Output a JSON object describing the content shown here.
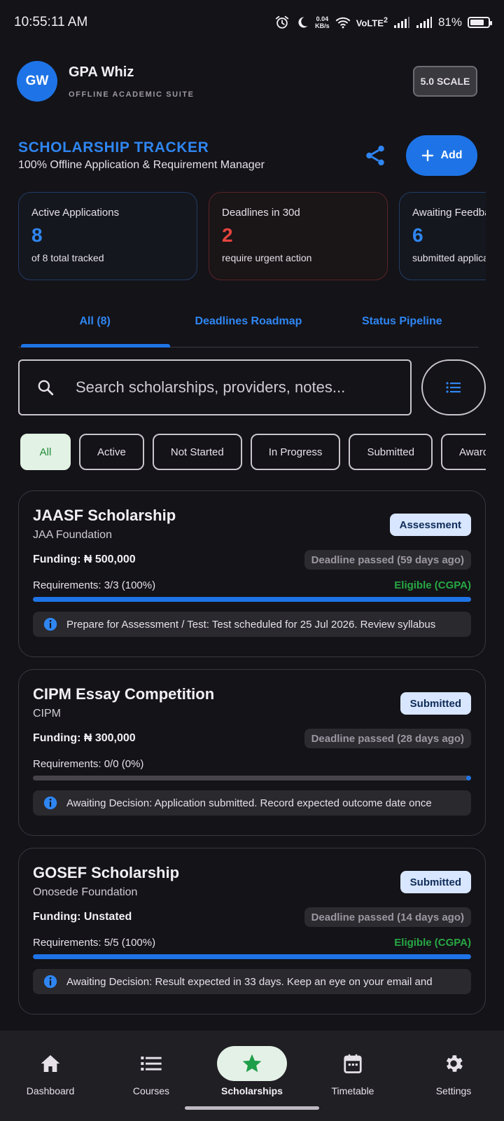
{
  "status_bar": {
    "time": "10:55:11 AM",
    "net_speed_value": "0.04",
    "net_speed_unit": "KB/s",
    "volte": "VoLTE",
    "volte_sup": "2",
    "battery": "81%",
    "battery_level": 0.81
  },
  "header": {
    "avatar_initials": "GW",
    "app_name": "GPA Whiz",
    "app_subtitle": "OFFLINE ACADEMIC SUITE",
    "scale_label": "5.0 SCALE"
  },
  "page": {
    "title": "SCHOLARSHIP TRACKER",
    "subtitle": "100% Offline Application & Requirement Manager",
    "add_label": "Add"
  },
  "stats": [
    {
      "label": "Active Applications",
      "value": "8",
      "footer": "of 8 total tracked"
    },
    {
      "label": "Deadlines in 30d",
      "value": "2",
      "footer": "require urgent action"
    },
    {
      "label": "Awaiting Feedback",
      "value": "6",
      "footer": "submitted applications"
    }
  ],
  "tabs": [
    {
      "label": "All (8)"
    },
    {
      "label": "Deadlines Roadmap"
    },
    {
      "label": "Status Pipeline"
    }
  ],
  "search": {
    "placeholder": "Search scholarships, providers, notes..."
  },
  "filter_chips": [
    {
      "label": "All"
    },
    {
      "label": "Active"
    },
    {
      "label": "Not Started"
    },
    {
      "label": "In Progress"
    },
    {
      "label": "Submitted"
    },
    {
      "label": "Awarded"
    }
  ],
  "scholarships": [
    {
      "title": "JAASF Scholarship",
      "provider": "JAA Foundation",
      "status": "Assessment",
      "funding": "Funding: ₦ 500,000",
      "deadline": "Deadline passed (59 days ago)",
      "requirements": "Requirements: 3/3 (100%)",
      "eligibility": "Eligible (CGPA)",
      "progress": 1.0,
      "note": "Prepare for Assessment / Test: Test scheduled for 25 Jul 2026. Review syllabus"
    },
    {
      "title": "CIPM Essay Competition",
      "provider": "CIPM",
      "status": "Submitted",
      "funding": "Funding: ₦ 300,000",
      "deadline": "Deadline passed (28 days ago)",
      "requirements": "Requirements: 0/0 (0%)",
      "eligibility": "",
      "progress": 0.0,
      "note": "Awaiting Decision: Application submitted. Record expected outcome date once"
    },
    {
      "title": "GOSEF Scholarship",
      "provider": "Onosede Foundation",
      "status": "Submitted",
      "funding": "Funding: Unstated",
      "deadline": "Deadline passed (14 days ago)",
      "requirements": "Requirements: 5/5 (100%)",
      "eligibility": "Eligible (CGPA)",
      "progress": 1.0,
      "note": "Awaiting Decision: Result expected in 33 days. Keep an eye on your email and"
    }
  ],
  "bottom_nav": [
    {
      "label": "Dashboard",
      "icon": "home-icon"
    },
    {
      "label": "Courses",
      "icon": "list-icon"
    },
    {
      "label": "Scholarships",
      "icon": "star-icon"
    },
    {
      "label": "Timetable",
      "icon": "calendar-icon"
    },
    {
      "label": "Settings",
      "icon": "gear-icon"
    }
  ],
  "colors": {
    "accent": "#1E74E6",
    "accent_text": "#2F86F2",
    "danger": "#E5443F",
    "success": "#27A844",
    "background": "#141318"
  }
}
